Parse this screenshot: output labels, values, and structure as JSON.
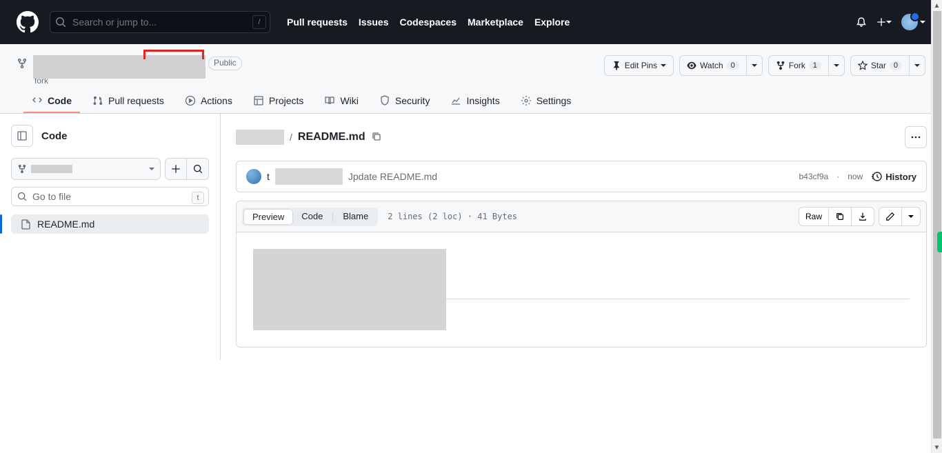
{
  "header": {
    "search_placeholder": "Search or jump to...",
    "slash": "/",
    "nav": [
      "Pull requests",
      "Issues",
      "Codespaces",
      "Marketplace",
      "Explore"
    ]
  },
  "repo": {
    "visibility": "Public",
    "fork_prefix": "fork",
    "actions": {
      "edit_pins": "Edit Pins",
      "watch": "Watch",
      "watch_count": "0",
      "fork": "Fork",
      "fork_count": "1",
      "star": "Star",
      "star_count": "0"
    },
    "tabs": [
      "Code",
      "Pull requests",
      "Actions",
      "Projects",
      "Wiki",
      "Security",
      "Insights",
      "Settings"
    ]
  },
  "sidebar": {
    "title": "Code",
    "goto": "Go to file",
    "kbd": "t",
    "file": "README.md"
  },
  "content": {
    "path_sep": "/",
    "file": "README.md",
    "commit_prefix": "t",
    "commit_msg": "Jpdate README.md",
    "commit_sha": "b43cf9a",
    "commit_dot": "·",
    "commit_time": "now",
    "history": "History",
    "view_tabs": [
      "Preview",
      "Code",
      "Blame"
    ],
    "stats": "2 lines (2 loc) · 41 Bytes",
    "raw": "Raw"
  }
}
